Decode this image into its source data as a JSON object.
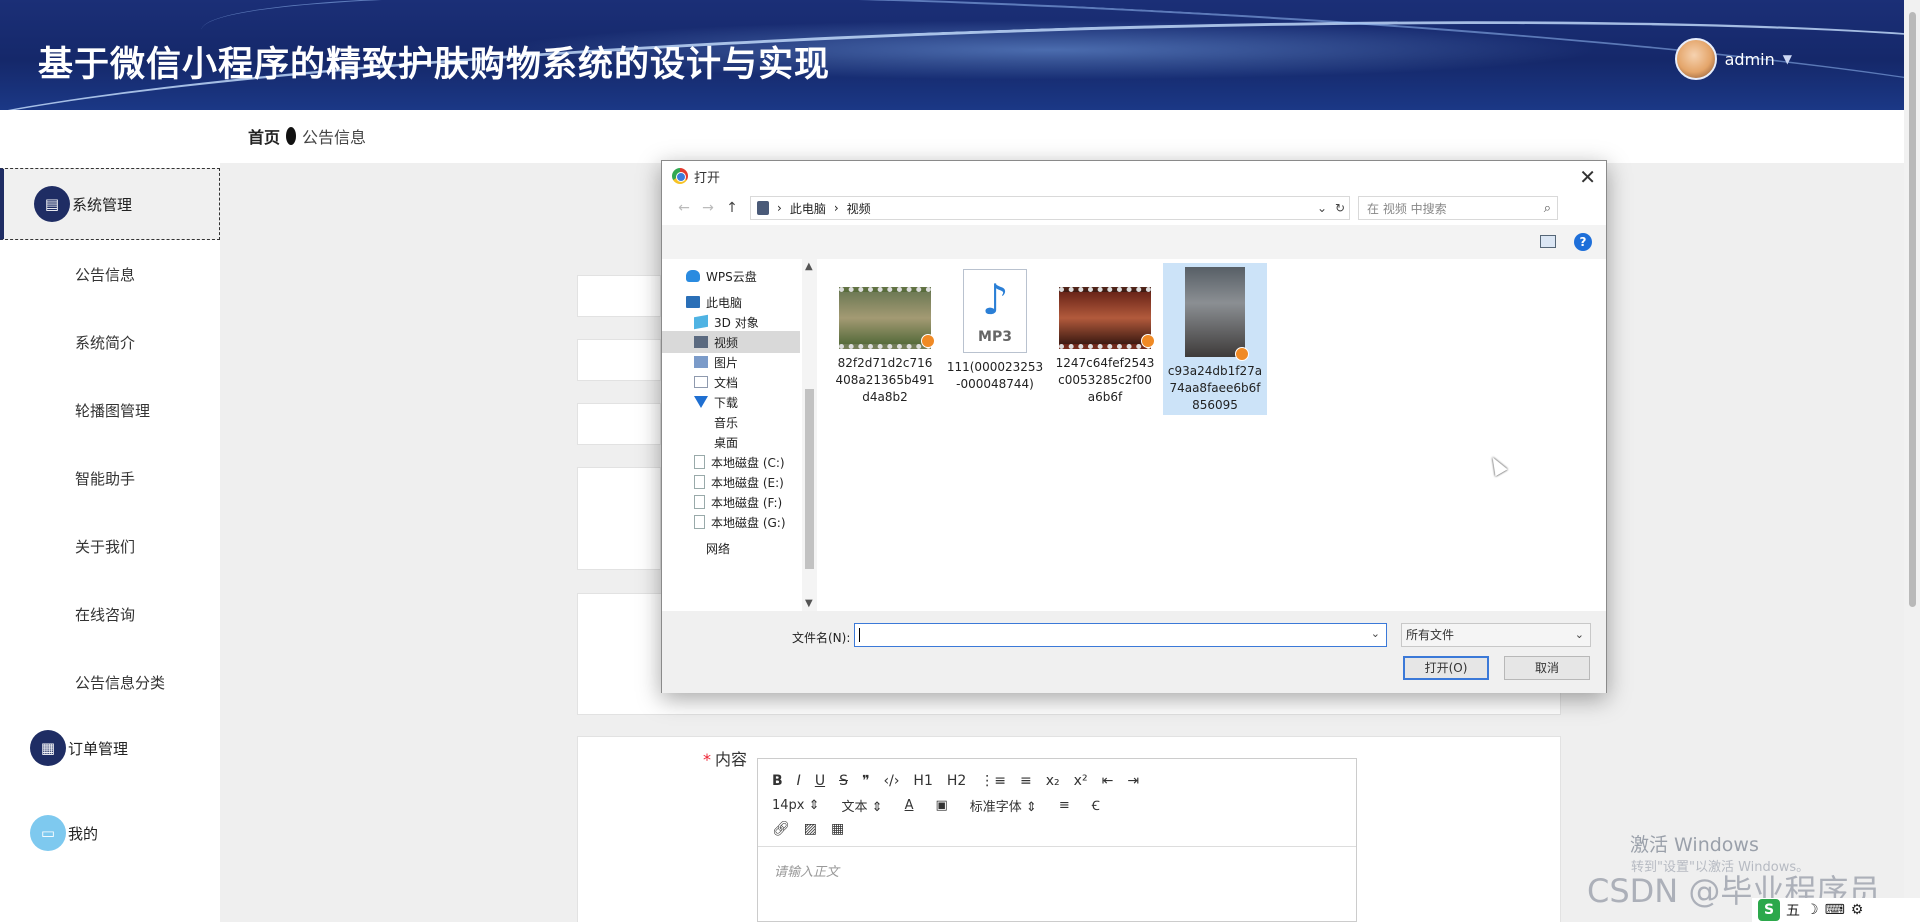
{
  "header": {
    "title": "基于微信小程序的精致护肤购物系统的设计与实现",
    "username": "admin",
    "caret": "▼"
  },
  "breadcrumb": {
    "home": "首页",
    "current": "公告信息"
  },
  "sidebar": {
    "groups": [
      {
        "label": "系统管理",
        "icon": "chart-icon"
      },
      {
        "label": "订单管理",
        "icon": "grid-icon"
      },
      {
        "label": "我的",
        "icon": "card-icon"
      }
    ],
    "items": [
      "公告信息",
      "系统简介",
      "轮播图管理",
      "智能助手",
      "关于我们",
      "在线咨询",
      "公告信息分类"
    ]
  },
  "form": {
    "content_label": "内容",
    "required_mark": "*"
  },
  "editor": {
    "toolbar_row1": [
      "B",
      "I",
      "U",
      "S",
      "❞",
      "‹/›",
      "H1",
      "H2",
      "⋮≡",
      "≡",
      "x₂",
      "x²",
      "⇤",
      "⇥"
    ],
    "font_size": "14px",
    "text_type": "文本",
    "font_family": "标准字体",
    "placeholder": "请输入正文"
  },
  "dialog": {
    "title": "打开",
    "close": "✕",
    "path": [
      "此电脑",
      "视频"
    ],
    "search_placeholder": "在 视频 中搜索",
    "help": "?",
    "nav": [
      {
        "label": "WPS云盘",
        "icon": "cloud-icon"
      },
      {
        "label": "此电脑",
        "icon": "pc-icon"
      },
      {
        "label": "3D 对象",
        "icon": "3d-icon"
      },
      {
        "label": "视频",
        "icon": "video-folder-icon",
        "selected": true
      },
      {
        "label": "图片",
        "icon": "picture-folder-icon"
      },
      {
        "label": "文档",
        "icon": "document-folder-icon"
      },
      {
        "label": "下载",
        "icon": "download-icon"
      },
      {
        "label": "音乐",
        "icon": "music-folder-icon"
      },
      {
        "label": "桌面",
        "icon": "desktop-folder-icon"
      },
      {
        "label": "本地磁盘 (C:)",
        "icon": "disk-icon"
      },
      {
        "label": "本地磁盘 (E:)",
        "icon": "disk-icon"
      },
      {
        "label": "本地磁盘 (F:)",
        "icon": "disk-icon"
      },
      {
        "label": "本地磁盘 (G:)",
        "icon": "disk-icon"
      },
      {
        "label": "网络",
        "icon": "network-icon"
      }
    ],
    "files": [
      {
        "name_lines": [
          "82f2d71d2c716",
          "408a21365b491",
          "d4a8b2"
        ],
        "kind": "video"
      },
      {
        "name_lines": [
          "111(000023253",
          "-000048744)"
        ],
        "kind": "mp3",
        "badge": "MP3"
      },
      {
        "name_lines": [
          "1247c64fef2543",
          "c0053285c2f00",
          "a6b6f"
        ],
        "kind": "video"
      },
      {
        "name_lines": [
          "c93a24db1f27a",
          "74aa8faee6b6f",
          "856095"
        ],
        "kind": "video",
        "selected": true
      }
    ],
    "filename_label": "文件名(N):",
    "filename_value": "",
    "filter": "所有文件",
    "open_button": "打开(O)",
    "cancel_button": "取消"
  },
  "watermark": {
    "activate_title": "激活 Windows",
    "activate_sub": "转到\"设置\"以激活 Windows。",
    "csdn": "CSDN @毕业程序员"
  },
  "tray": {
    "ime": "五",
    "s_label": "S"
  }
}
